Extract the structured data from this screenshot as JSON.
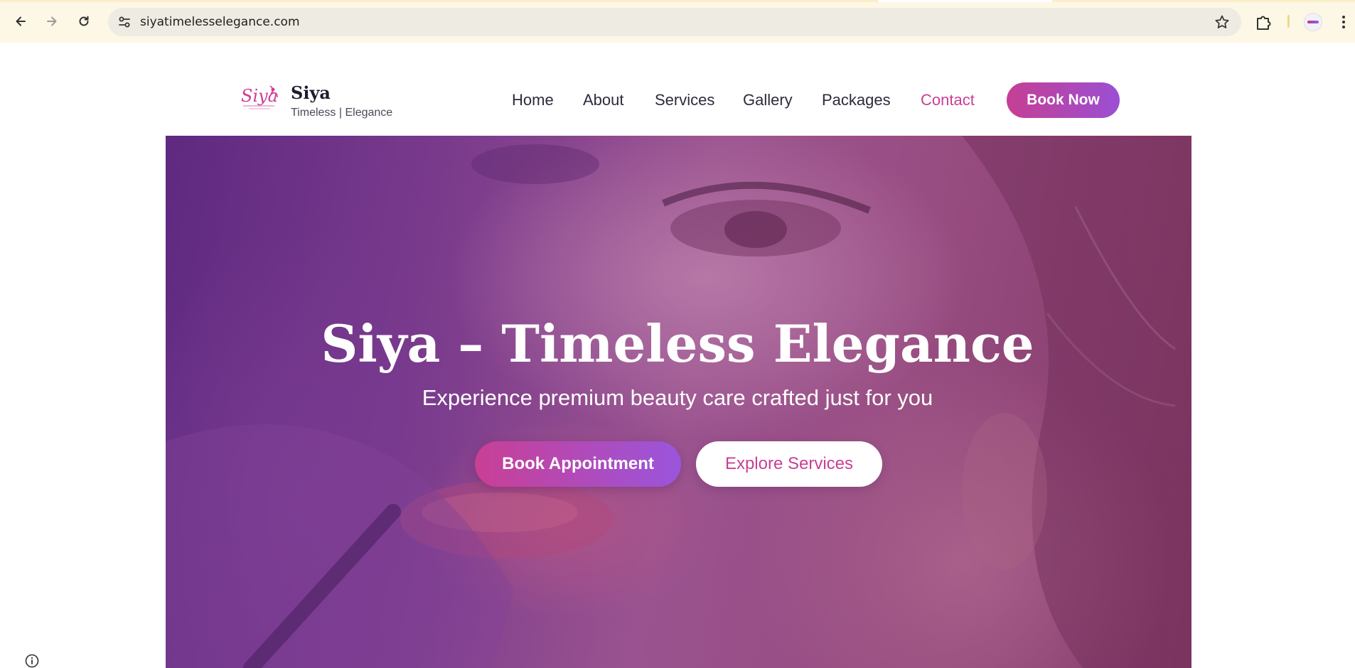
{
  "browser": {
    "url": "siyatimelesselegance.com",
    "icons": {
      "back": "arrow-left-icon",
      "forward": "arrow-right-icon",
      "reload": "reload-icon",
      "site_info": "tune-icon",
      "bookmark": "star-icon",
      "extensions": "puzzle-icon",
      "menu": "kebab-menu-icon"
    }
  },
  "header": {
    "brand_name": "Siya",
    "brand_tagline": "Timeless | Elegance",
    "logo_script": "Siya",
    "nav": [
      {
        "label": "Home",
        "active": false
      },
      {
        "label": "About",
        "active": false
      },
      {
        "label": "Services",
        "active": false
      },
      {
        "label": "Gallery",
        "active": false
      },
      {
        "label": "Packages",
        "active": false
      },
      {
        "label": "Contact",
        "active": true
      }
    ],
    "cta_label": "Book Now"
  },
  "hero": {
    "title": "Siya – Timeless Elegance",
    "subtitle": "Experience premium beauty care crafted just for you",
    "primary_button": "Book Appointment",
    "secondary_button": "Explore Services"
  },
  "colors": {
    "accent_pink": "#c93f94",
    "accent_purple": "#9a55dc",
    "text_dark": "#2c2c3c"
  }
}
